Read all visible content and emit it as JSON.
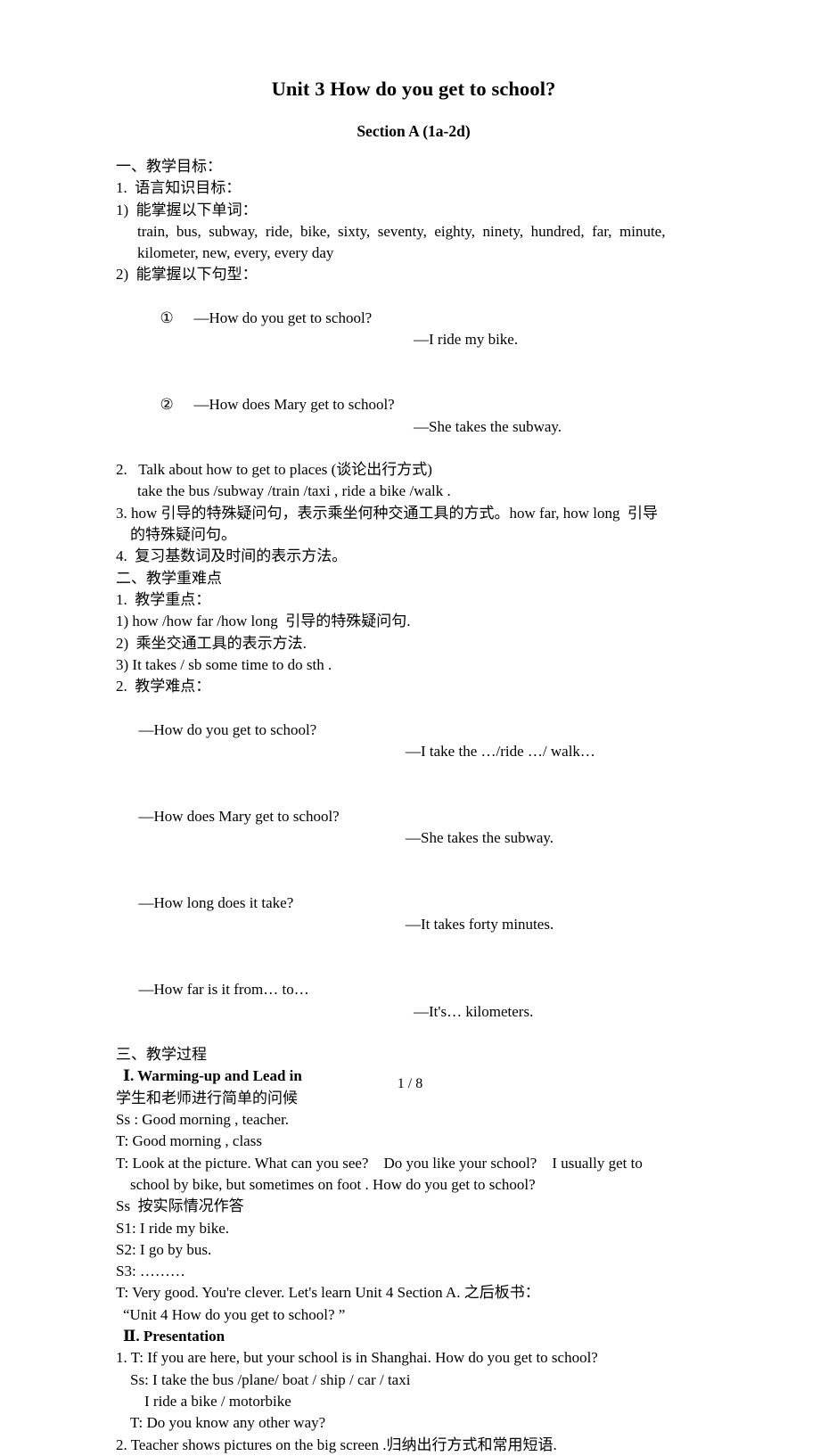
{
  "document": {
    "title": "Unit 3 How do you get to school?",
    "subtitle": "Section A (1a-2d)",
    "footer": "1 / 8"
  },
  "objectives": {
    "heading": "一、教学目标：",
    "item1": "1.  语言知识目标：",
    "sub1": "1)  能掌握以下单词：",
    "words_line1": "train,  bus,  subway,  ride,  bike,  sixty,  seventy,  eighty,  ninety,  hundred,  far,  minute,",
    "words_line2": "kilometer, new, every, every day",
    "sub2": "2)  能掌握以下句型：",
    "patterns": [
      {
        "marker": "①",
        "question": "—How do you get to school?",
        "answer": "—I ride my bike."
      },
      {
        "marker": "②",
        "question": "—How does Mary get to school?",
        "answer": "—She takes the subway."
      }
    ],
    "item2": "2.   Talk about how to get to places (谈论出行方式)",
    "item2_sub": "take the bus /subway /train /taxi , ride a bike /walk .",
    "item3_line1": "3. how 引导的特殊疑问句，表示乘坐何种交通工具的方式。how far, how long  引导",
    "item3_line2": "的特殊疑问句。",
    "item4": "4.  复习基数词及时间的表示方法。"
  },
  "key_points": {
    "heading": "二、教学重难点",
    "focus_heading": "1.  教学重点：",
    "focus_items": [
      "1) how /how far /how long  引导的特殊疑问句.",
      "2)  乘坐交通工具的表示方法.",
      "3) It takes / sb some time to do sth ."
    ],
    "difficulty_heading": "2.  教学难点：",
    "dialogues": [
      {
        "question": "—How do you get to school?",
        "answer": "—I take the …/ride …/ walk…"
      },
      {
        "question": "—How does Mary get to school?",
        "answer": "—She takes the subway."
      },
      {
        "question": "—How long does it take?",
        "answer": "—It takes forty minutes."
      },
      {
        "question": "—How far is it from… to…",
        "answer": "—It's… kilometers."
      }
    ]
  },
  "process": {
    "heading": "三、教学过程",
    "section1_title": "Ⅰ. Warming-up and Lead in",
    "section1_lines": [
      "学生和老师进行简单的问候",
      "Ss : Good morning , teacher.",
      "T: Good morning , class"
    ],
    "teacher_prompt_line1": "T: Look at the picture. What can you see?    Do you like your school?    I usually get to",
    "teacher_prompt_line2": "school by bike, but sometimes on foot . How do you get to school?",
    "responses": [
      "Ss  按实际情况作答",
      "S1: I ride my bike.",
      "S2: I go by bus.",
      "S3: ………"
    ],
    "teacher_closing": "T: Very good. You're clever. Let's learn Unit 4 Section A. 之后板书：",
    "board_writing": "“Unit 4 How do you get to school? ”",
    "section2_title": "Ⅱ. Presentation",
    "section2_lines": [
      "1. T: If you are here, but your school is in Shanghai. How do you get to school?",
      "Ss: I take the bus /plane/ boat / ship / car / taxi",
      "I ride a bike / motorbike",
      "T: Do you know any other way?",
      "2. Teacher shows pictures on the big screen .归纳出行方式和常用短语."
    ]
  }
}
